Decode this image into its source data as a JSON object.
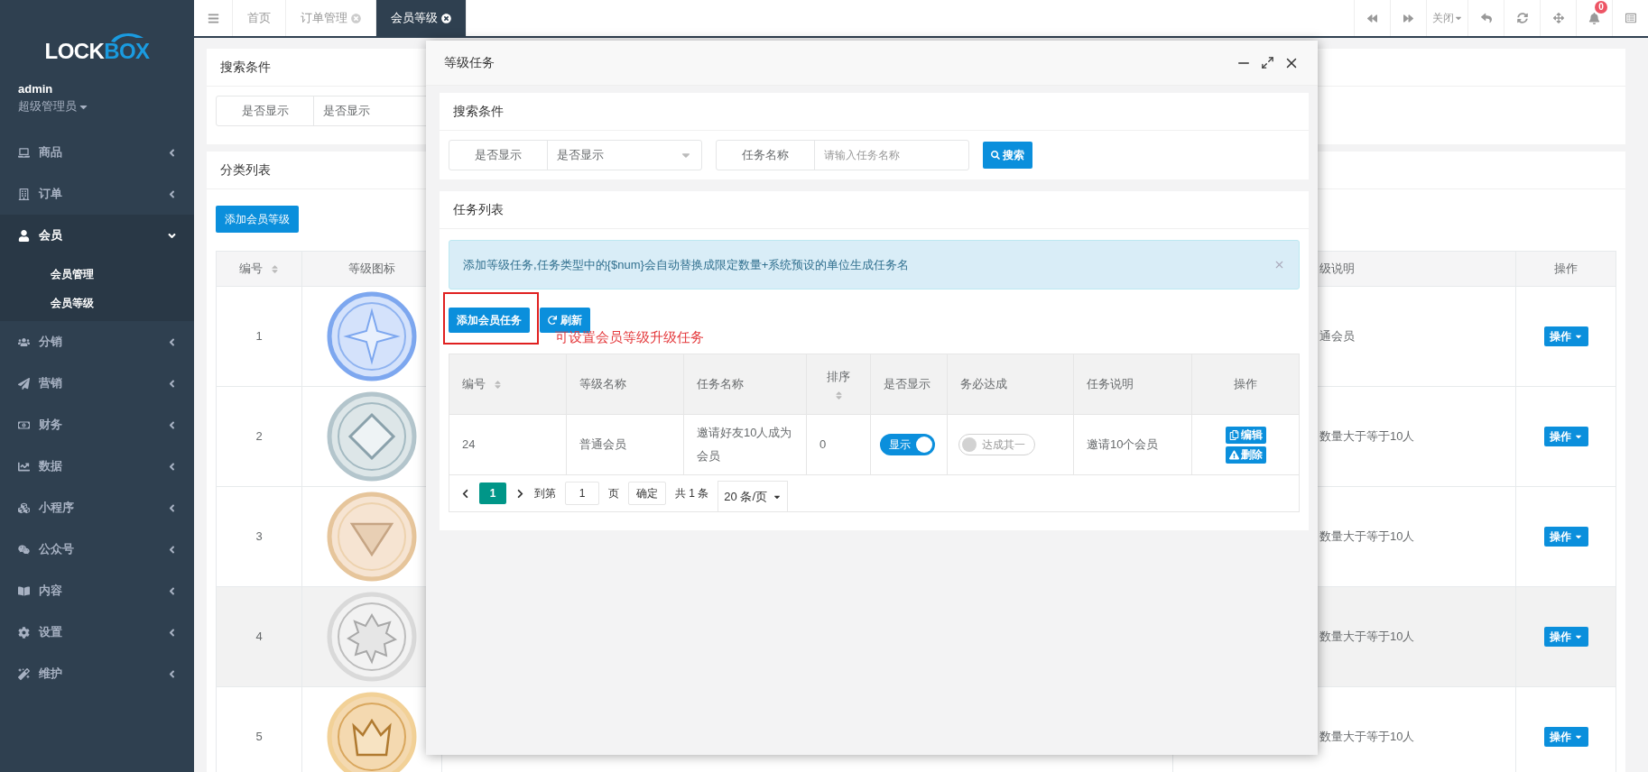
{
  "sidebar": {
    "logo": {
      "prefix": "LOCK",
      "suffix": "BOX"
    },
    "user": {
      "name": "admin",
      "role": "超级管理员"
    },
    "items": [
      {
        "label": "商品",
        "expanded": false
      },
      {
        "label": "订单",
        "expanded": false
      },
      {
        "label": "会员",
        "expanded": true,
        "children": [
          {
            "label": "会员管理"
          },
          {
            "label": "会员等级"
          }
        ]
      },
      {
        "label": "分销",
        "expanded": false
      },
      {
        "label": "营销",
        "expanded": false
      },
      {
        "label": "财务",
        "expanded": false
      },
      {
        "label": "数据",
        "expanded": false
      },
      {
        "label": "小程序",
        "expanded": false
      },
      {
        "label": "公众号",
        "expanded": false
      },
      {
        "label": "内容",
        "expanded": false
      },
      {
        "label": "设置",
        "expanded": false
      },
      {
        "label": "维护",
        "expanded": false
      }
    ]
  },
  "tabs": [
    {
      "label": "首页",
      "selected": false,
      "closable": false
    },
    {
      "label": "订单管理",
      "selected": false,
      "closable": true
    },
    {
      "label": "会员等级",
      "selected": true,
      "closable": true
    }
  ],
  "toolbar": {
    "close_menu": "关闭",
    "notifications": "0"
  },
  "page": {
    "search_card": {
      "title": "搜索条件",
      "filter_label": "是否显示",
      "filter_value": "是否显示"
    },
    "list_card": {
      "title": "分类列表",
      "add_button": "添加会员等级",
      "columns": [
        "编号",
        "等级图标",
        "级说明",
        "操作"
      ],
      "rows": [
        {
          "id": "1",
          "kind": "star",
          "description": "通会员",
          "action": "操作",
          "highlighted": false
        },
        {
          "id": "2",
          "kind": "diamond",
          "description": "数量大于等于10人",
          "action": "操作",
          "highlighted": false
        },
        {
          "id": "3",
          "kind": "triangle",
          "description": "数量大于等于10人",
          "action": "操作",
          "highlighted": false
        },
        {
          "id": "4",
          "kind": "octagram",
          "description": "数量大于等于10人",
          "action": "操作",
          "highlighted": true
        },
        {
          "id": "5",
          "kind": "crown",
          "description": "数量大于等于10人",
          "action": "操作",
          "highlighted": false
        }
      ]
    }
  },
  "modal": {
    "title": "等级任务",
    "search_card": {
      "title": "搜索条件",
      "filter_label": "是否显示",
      "filter_value": "是否显示",
      "name_label": "任务名称",
      "name_placeholder": "请输入任务名称",
      "search_button": "搜索"
    },
    "list_card": {
      "title": "任务列表",
      "alert": "添加等级任务,任务类型中的{$num}会自动替换成限定数量+系统预设的单位生成任务名",
      "add_button": "添加会员任务",
      "refresh_button": "刷新",
      "annotation": "可设置会员等级升级任务",
      "columns": [
        {
          "label": "编号",
          "kind": "sortable"
        },
        {
          "label": "等级名称",
          "kind": "plain"
        },
        {
          "label": "任务名称",
          "kind": "plain"
        },
        {
          "label": "排序",
          "kind": "stacked"
        },
        {
          "label": "是否显示",
          "kind": "plain"
        },
        {
          "label": "务必达成",
          "kind": "plain"
        },
        {
          "label": "任务说明",
          "kind": "plain"
        },
        {
          "label": "操作",
          "kind": "plain"
        }
      ],
      "rows": [
        {
          "id": "24",
          "level_name": "普通会员",
          "task_name": "邀请好友10人成为会员",
          "order": "0",
          "visible": {
            "label": "显示",
            "on": true
          },
          "required": {
            "label": "达成其一",
            "on": false
          },
          "description": "邀请10个会员",
          "edit": "编辑",
          "delete": "删除"
        }
      ],
      "pagination": {
        "pages": [
          {
            "label": "1",
            "selected": true
          }
        ],
        "goto_label": "到第",
        "goto_value": "1",
        "page_unit": "页",
        "confirm": "确定",
        "total": "共 1 条",
        "page_size": "20 条/页"
      }
    }
  }
}
